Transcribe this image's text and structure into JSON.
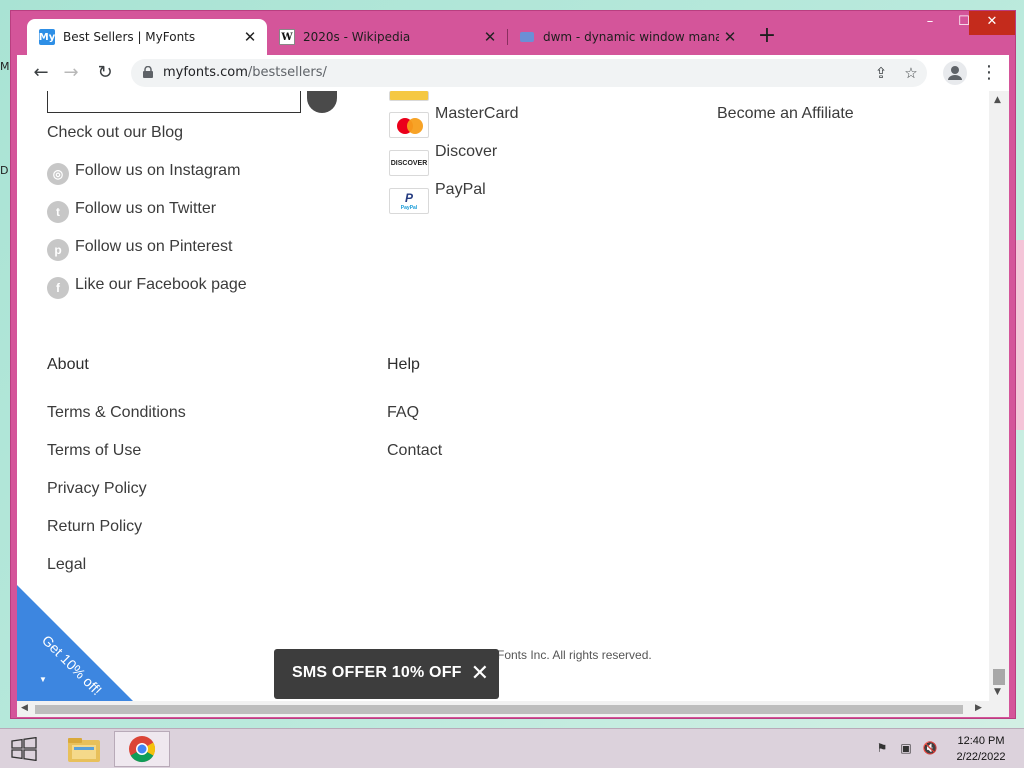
{
  "browser": {
    "tabs": [
      {
        "title": "Best Sellers | MyFonts",
        "active": true,
        "favicon": "myfonts-icon"
      },
      {
        "title": "2020s - Wikipedia",
        "active": false,
        "favicon": "wikipedia-icon"
      },
      {
        "title": "dwm - dynamic window manage",
        "active": false,
        "favicon": "suckless-icon"
      }
    ],
    "url_host": "myfonts.com",
    "url_path": "/bestsellers/"
  },
  "footer": {
    "blog_link": "Check out our Blog",
    "social": [
      {
        "label": "Follow us on Instagram",
        "icon": "instagram-icon"
      },
      {
        "label": "Follow us on Twitter",
        "icon": "twitter-icon"
      },
      {
        "label": "Follow us on Pinterest",
        "icon": "pinterest-icon"
      },
      {
        "label": "Like our Facebook page",
        "icon": "facebook-icon"
      }
    ],
    "payments": [
      {
        "label": "MasterCard",
        "icon": "mastercard-icon"
      },
      {
        "label": "Discover",
        "icon": "discover-icon"
      },
      {
        "label": "PayPal",
        "icon": "paypal-icon"
      }
    ],
    "affiliate_link": "Become an Affiliate",
    "about": {
      "heading": "About",
      "links": [
        "Terms & Conditions",
        "Terms of Use",
        "Privacy Policy",
        "Return Policy",
        "Legal"
      ]
    },
    "help": {
      "heading": "Help",
      "links": [
        "FAQ",
        "Contact"
      ]
    },
    "copyright": "Fonts Inc. All rights reserved.",
    "discover_logo_text": "DISCOVER",
    "paypal_logo_text": "PayPal"
  },
  "promo": {
    "ribbon": "Get 10% off!",
    "sms_offer": "SMS OFFER 10% OFF"
  },
  "taskbar": {
    "time": "12:40 PM",
    "date": "2/22/2022"
  },
  "colors": {
    "window_frame": "#d4559a",
    "ribbon": "#3d86e0",
    "close_button": "#c42b1c"
  }
}
